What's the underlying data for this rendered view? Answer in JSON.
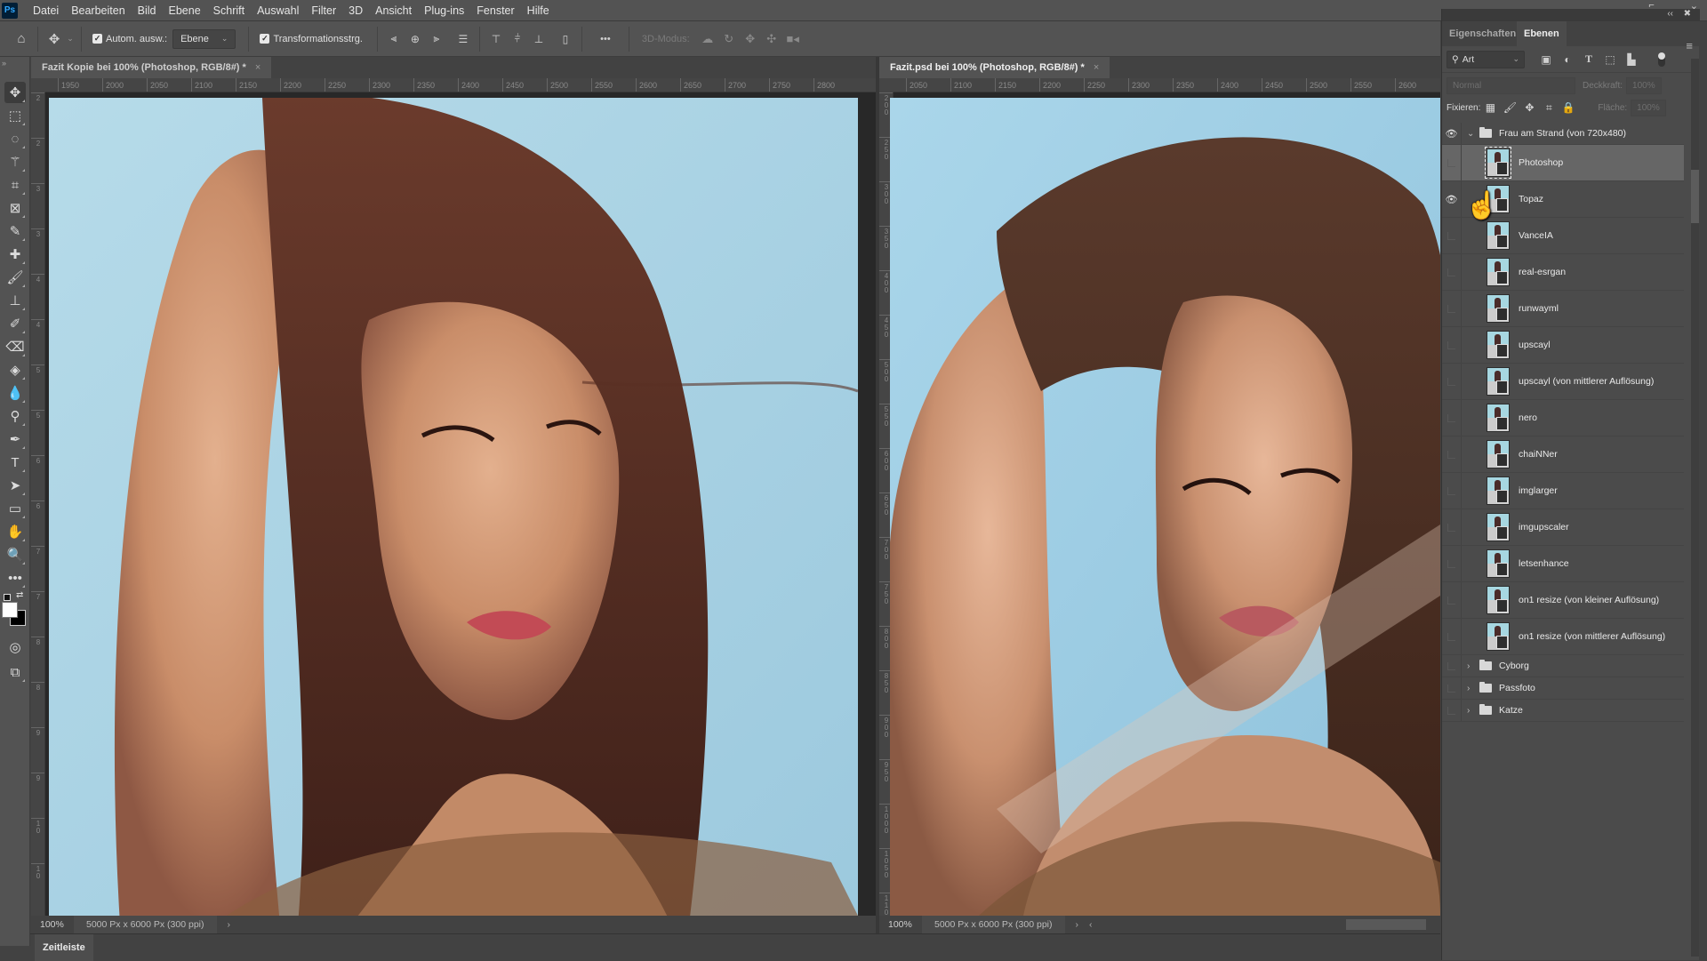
{
  "app": {
    "logo": "Ps"
  },
  "menu": [
    "Datei",
    "Bearbeiten",
    "Bild",
    "Ebene",
    "Schrift",
    "Auswahl",
    "Filter",
    "3D",
    "Ansicht",
    "Plug-ins",
    "Fenster",
    "Hilfe"
  ],
  "options": {
    "auto_select_label": "Autom. ausw.:",
    "auto_select_checked": true,
    "auto_select_target": "Ebene",
    "transform_label": "Transformationsstrg.",
    "transform_checked": true,
    "more_label": "•••",
    "mode_3d_label": "3D-Modus:"
  },
  "documents": [
    {
      "tab_title": "Fazit Kopie bei 100% (Photoshop, RGB/8#) *",
      "close": "×",
      "ruler_h": [
        "1950",
        "2000",
        "2050",
        "2100",
        "2150",
        "2200",
        "2250",
        "2300",
        "2350",
        "2400",
        "2450",
        "2500",
        "2550",
        "2600",
        "2650",
        "2700",
        "2750",
        "2800"
      ],
      "ruler_v": [
        "2",
        "2",
        "3",
        "3",
        "4",
        "4",
        "5",
        "5",
        "6",
        "6",
        "7",
        "7",
        "8",
        "8",
        "9",
        "9",
        "10",
        "10"
      ],
      "zoom": "100%",
      "info": "5000 Px x 6000 Px (300 ppi)",
      "arrow": "›"
    },
    {
      "tab_title": "Fazit.psd bei 100% (Photoshop, RGB/8#) *",
      "close": "×",
      "ruler_h": [
        "2050",
        "2100",
        "2150",
        "2200",
        "2250",
        "2300",
        "2350",
        "2400",
        "2450",
        "2500",
        "2550",
        "2600"
      ],
      "ruler_v": [
        "200",
        "250",
        "300",
        "350",
        "400",
        "450",
        "500",
        "550",
        "600",
        "650",
        "700",
        "750",
        "800",
        "850",
        "900",
        "950",
        "1000",
        "1050",
        "1100"
      ],
      "zoom": "100%",
      "info": "5000 Px x 6000 Px (300 ppi)",
      "arrow": "›",
      "arrow_back": "‹"
    }
  ],
  "timeline": {
    "label": "Zeitleiste"
  },
  "panel": {
    "tabs": [
      "Eigenschaften",
      "Ebenen"
    ],
    "active_tab": "Ebenen",
    "filter_kind": "Art",
    "blend_mode": "Normal",
    "opacity_label": "Deckkraft:",
    "opacity_value": "100%",
    "lock_label": "Fixieren:",
    "fill_label": "Fläche:",
    "fill_value": "100%",
    "group_open": {
      "name": "Frau am Strand (von 720x480)",
      "visible": true
    },
    "layers": [
      {
        "name": "Photoshop",
        "visible": false,
        "selected": true
      },
      {
        "name": "Topaz",
        "visible": true,
        "selected": false
      },
      {
        "name": "VanceIA",
        "visible": false,
        "selected": false
      },
      {
        "name": "real-esrgan",
        "visible": false,
        "selected": false
      },
      {
        "name": "runwayml",
        "visible": false,
        "selected": false
      },
      {
        "name": "upscayl",
        "visible": false,
        "selected": false
      },
      {
        "name": "upscayl (von mittlerer Auflösung)",
        "visible": false,
        "selected": false
      },
      {
        "name": "nero",
        "visible": false,
        "selected": false
      },
      {
        "name": "chaiNNer",
        "visible": false,
        "selected": false
      },
      {
        "name": "imglarger",
        "visible": false,
        "selected": false
      },
      {
        "name": "imgupscaler",
        "visible": false,
        "selected": false
      },
      {
        "name": "letsenhance",
        "visible": false,
        "selected": false
      },
      {
        "name": "on1 resize (von kleiner Auflösung)",
        "visible": false,
        "selected": false
      },
      {
        "name": "on1 resize (von mittlerer Auflösung)",
        "visible": false,
        "selected": false
      }
    ],
    "groups_closed": [
      {
        "name": "Cyborg",
        "visible": false
      },
      {
        "name": "Passfoto",
        "visible": false
      },
      {
        "name": "Katze",
        "visible": false
      }
    ]
  },
  "colors": {
    "ui_bg": "#535353",
    "panel_bg": "#4b4b4b",
    "ps_blue": "#31a8ff",
    "sky": "#a9d4e6"
  }
}
